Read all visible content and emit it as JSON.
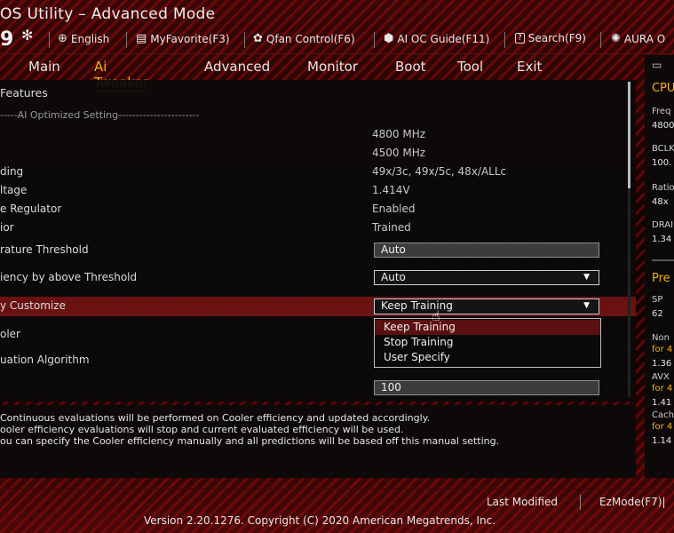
{
  "header": {
    "title": "OS Utility – Advanced Mode",
    "date_partial": "9",
    "toolbar": [
      {
        "icon": "globe-icon",
        "label": "English"
      },
      {
        "icon": "favorite-icon",
        "label": "MyFavorite(F3)"
      },
      {
        "icon": "fan-icon",
        "label": "Qfan Control(F6)"
      },
      {
        "icon": "ai-oc-icon",
        "label": "AI OC Guide(F11)"
      },
      {
        "icon": "search-icon",
        "label": "Search(F9)"
      },
      {
        "icon": "aura-icon",
        "label": "AURA O"
      }
    ]
  },
  "nav": {
    "tabs": [
      "Main",
      "Ai Tweaker",
      "Advanced",
      "Monitor",
      "Boot",
      "Tool",
      "Exit"
    ],
    "active": "Ai Tweaker"
  },
  "main": {
    "section_title": "Features",
    "subheader": "-----AI Optimized Setting-----------------------",
    "info_rows": [
      {
        "label": "",
        "value": "4800 MHz"
      },
      {
        "label": "",
        "value": "4500 MHz"
      },
      {
        "label": "ding",
        "value": "49x/3c, 49x/5c, 48x/ALLc"
      },
      {
        "label": "ltage",
        "value": "1.414V"
      },
      {
        "label": "e Regulator",
        "value": "Enabled"
      },
      {
        "label": "ior",
        "value": "Trained"
      }
    ],
    "settings": [
      {
        "label": "rature Threshold",
        "value": "Auto"
      },
      {
        "label": "iency by above Threshold",
        "value": "Auto"
      },
      {
        "label": "y Customize",
        "value": "Keep Training"
      },
      {
        "label": "oler",
        "value": ""
      },
      {
        "label": "uation Algorithm",
        "value": ""
      },
      {
        "label": "",
        "value": "100"
      }
    ],
    "dropdown_options": [
      "Keep Training",
      "Stop Training",
      "User Specify"
    ]
  },
  "help": {
    "lines": [
      "Continuous evaluations will be performed on Cooler efficiency and updated accordingly.",
      "ooler efficiency evaluations will stop and current evaluated efficiency will be used.",
      "ou can specify the Cooler efficiency manually and all predictions will be based off this manual setting."
    ]
  },
  "side_panel": {
    "cpu_heading": "CPU",
    "items": [
      {
        "label": "Freq",
        "value": "4800"
      },
      {
        "label": "BCLK",
        "value": "100."
      },
      {
        "label": "Ratio",
        "value": "48x"
      },
      {
        "label": "DRAI",
        "value": "1.34"
      }
    ],
    "pre_heading": "Pre",
    "pre_items": [
      {
        "label": "SP",
        "value": "62"
      },
      {
        "label": "Non",
        "for": "for 4",
        "value": "1.36"
      },
      {
        "label": "AVX",
        "for": "for 4",
        "value": "1.41"
      },
      {
        "label": "Cach",
        "for": "for 4",
        "value": "1.14"
      }
    ]
  },
  "footer": {
    "last_modified": "Last Modified",
    "ezmode": "EzMode(F7)|",
    "version": "Version 2.20.1276. Copyright (C) 2020 American Megatrends, Inc."
  },
  "colors": {
    "accent": "#f2b21a",
    "highlight": "#6a1212"
  }
}
